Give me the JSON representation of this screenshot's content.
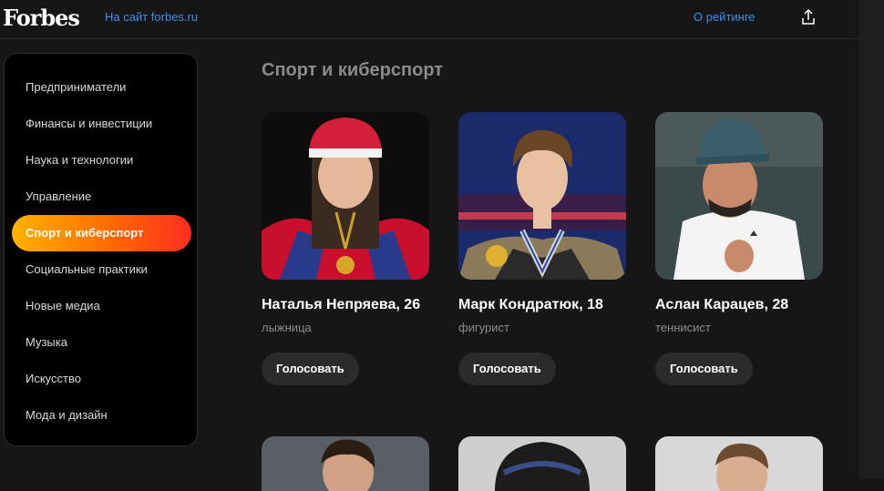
{
  "header": {
    "logo": "Forbes",
    "site_link": "На сайт forbes.ru",
    "about_link": "О рейтинге",
    "share_icon": "share-icon"
  },
  "sidebar": {
    "items": [
      {
        "label": "Предприниматели"
      },
      {
        "label": "Финансы и инвестиции"
      },
      {
        "label": "Наука и технологии"
      },
      {
        "label": "Управление"
      },
      {
        "label": "Спорт и киберспорт"
      },
      {
        "label": "Социальные практики"
      },
      {
        "label": "Новые медиа"
      },
      {
        "label": "Музыка"
      },
      {
        "label": "Искусство"
      },
      {
        "label": "Мода и дизайн"
      }
    ],
    "active_label": "Спорт и киберспорт"
  },
  "section": {
    "title": "Спорт и киберспорт"
  },
  "cards": [
    {
      "name": "Наталья Непряева, 26",
      "role": "лыжница",
      "vote": "Голосовать"
    },
    {
      "name": "Марк Кондратюк, 18",
      "role": "фигурист",
      "vote": "Голосовать"
    },
    {
      "name": "Аслан Карацев, 28",
      "role": "теннисист",
      "vote": "Голосовать"
    }
  ],
  "colors": {
    "accent_link": "#3d8ef0",
    "active_gradient_start": "#ffb300",
    "active_gradient_end": "#ff2d20",
    "background": "#161616"
  }
}
